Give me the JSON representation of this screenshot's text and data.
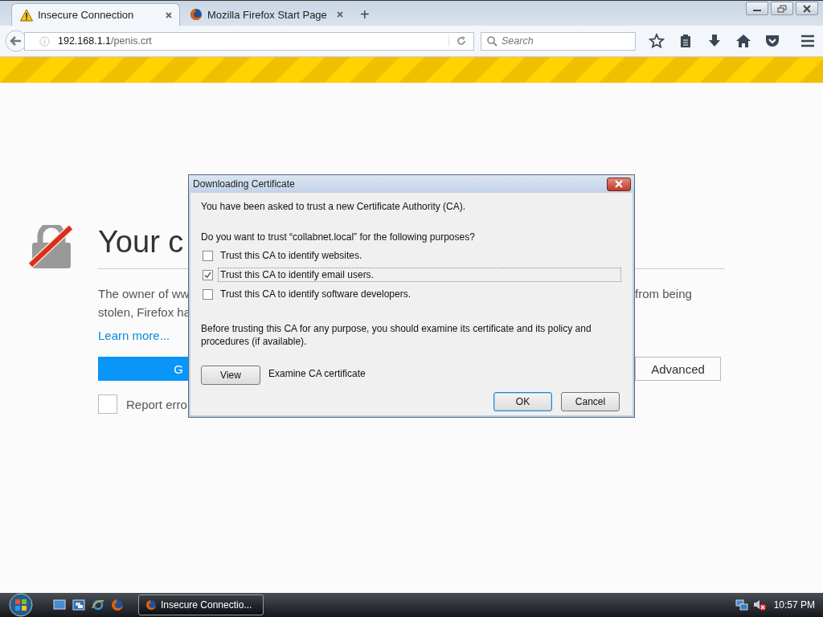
{
  "browser": {
    "tabs": [
      {
        "label": "Insecure Connection",
        "selected": true
      },
      {
        "label": "Mozilla Firefox Start Page",
        "selected": false
      }
    ],
    "new_tab": "+",
    "url": {
      "host": "192.168.1.1",
      "path": "/penis.crt"
    },
    "search": {
      "placeholder": "Search"
    }
  },
  "page": {
    "heading": "Your c",
    "line_1_left": "The owner of ww",
    "line_1_right": "from being",
    "line_2": "stolen, Firefox ha",
    "link": "Learn more...",
    "primary_button": "G",
    "secondary_button": "Advanced",
    "report": {
      "label": "Report erro",
      "checked": false
    }
  },
  "dialog": {
    "title": "Downloading Certificate",
    "intro": "You have been asked to trust a new Certificate Authority (CA).",
    "question": "Do you want to trust “collabnet.local” for the following purposes?",
    "options": [
      {
        "label": "Trust this CA to identify websites.",
        "checked": false,
        "focused": false
      },
      {
        "label": "Trust this CA to identify email users.",
        "checked": true,
        "focused": true
      },
      {
        "label": "Trust this CA to identify software developers.",
        "checked": false,
        "focused": false
      }
    ],
    "note": "Before trusting this CA for any purpose, you should examine its certificate and its policy and procedures (if available).",
    "view_button": "View",
    "view_label": "Examine CA certificate",
    "buttons": [
      {
        "label": "OK",
        "default": true
      },
      {
        "label": "Cancel",
        "default": false
      }
    ]
  },
  "taskbar": {
    "task": {
      "label": "Insecure Connectio...",
      "selected": true
    },
    "clock": "10:57 PM"
  }
}
